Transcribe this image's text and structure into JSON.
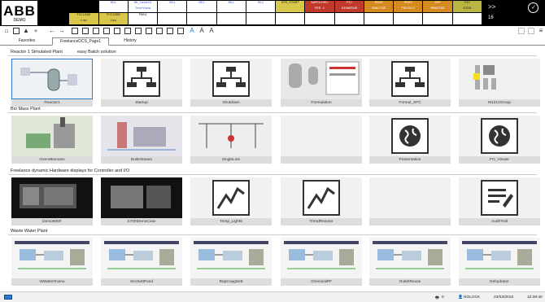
{
  "app": {
    "logo": "ABB",
    "logo_sub": "DEMO"
  },
  "alarm_cells": [
    [
      "",
      "",
      "051",
      "Hb_Case43\nTestView",
      "051",
      "051",
      "051",
      "051",
      "EPS_START",
      "SAFELEVEL\nPER 1",
      "PIC\nHIDAMIUM",
      "RSV3\nMONITOR",
      "RSV3\nPROTECT",
      "SVP\nMONITOR",
      "PIC\nHIGH"
    ],
    [
      "",
      "FCC1390\nLow",
      "FCC1390\nLow",
      "P301",
      "",
      "",
      "",
      "",
      "",
      "",
      "",
      "",
      "",
      "",
      ""
    ]
  ],
  "cell_colors": {
    "yellow": "#d9c74a",
    "white": "#ffffff",
    "red": "#c0392b",
    "amber": "#d48a1e",
    "olive": "#b8b640",
    "blue_text": "#2a4fd0",
    "black": "#000000"
  },
  "top_right": {
    "chevrons": ">>",
    "count": "16",
    "check_icon": "check-circle-icon"
  },
  "tabs": [
    "Favorites",
    "FreelanceDCS_Page1",
    "History"
  ],
  "sections": [
    {
      "title": "Reactor 1 Simulated Plant",
      "subtitle": "easy Batch solution",
      "tiles": [
        "Reactor1",
        "Startup",
        "Shutdown",
        "Formulation",
        "Formul_SFC",
        "M1212Group"
      ]
    },
    {
      "title": "Bio Mass Plant",
      "subtitle": "",
      "tiles": [
        "OvervBiomass",
        "BoilerSteam",
        "SingleLine",
        "",
        "Presentation",
        "FO_Viewer"
      ]
    },
    {
      "title": "Freelance dynamic Hardware displays for Controller and I/O",
      "subtitle": "",
      "tiles": [
        "Demo800F",
        "S700DemoCase",
        "Temp_Light9",
        "TrendReactor",
        "",
        "AuditTrail"
      ]
    },
    {
      "title": "Waste Water Plant",
      "subtitle": "",
      "tiles": [
        "WWaterOverw",
        "SecSettPond",
        "RapCoagSett",
        "ChemicalPF",
        "OutletReuse",
        "Dehydrator"
      ]
    }
  ],
  "status": {
    "printer_count": "0",
    "user": "NOLOCK",
    "date": "23/03/2018",
    "time": "10:39:40"
  }
}
